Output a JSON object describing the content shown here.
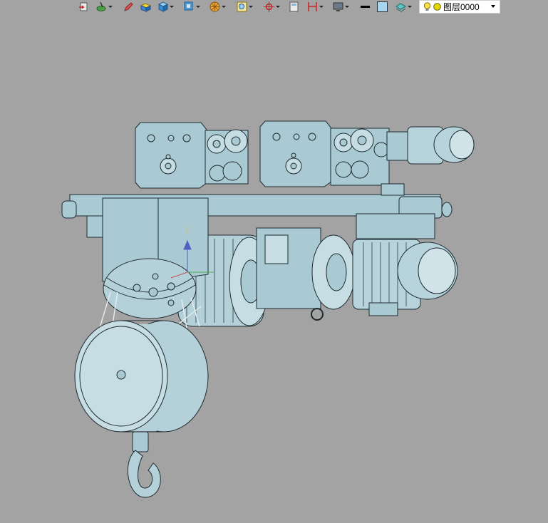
{
  "toolbar": {
    "tools": [
      {
        "name": "insert-block-icon",
        "dropdown": false
      },
      {
        "name": "globe-pen-icon",
        "dropdown": true
      },
      {
        "name": "pencil-icon",
        "dropdown": false
      },
      {
        "name": "box-yellow-icon",
        "dropdown": false
      },
      {
        "name": "cube-blue-icon",
        "dropdown": true
      },
      {
        "name": "view-cube-icon",
        "dropdown": true
      },
      {
        "name": "render-wheel-icon",
        "dropdown": true
      },
      {
        "name": "zoom-window-icon",
        "dropdown": true
      },
      {
        "name": "ucs-origin-icon",
        "dropdown": true
      },
      {
        "name": "calculator-icon",
        "dropdown": false
      },
      {
        "name": "dimension-icon",
        "dropdown": true
      },
      {
        "name": "monitor-icon",
        "dropdown": true
      },
      {
        "name": "lineweight-icon",
        "dropdown": false
      },
      {
        "name": "color-swatch-icon",
        "dropdown": false
      },
      {
        "name": "layer-stack-icon",
        "dropdown": true
      }
    ],
    "layer": {
      "name": "图层0000",
      "bulb_color": "#f6e04a",
      "sun_color": "#e6d800"
    }
  },
  "viewport": {
    "background": "#a3a3a3",
    "model_fill": "#a9c9d3",
    "model_stroke": "#1e2a30"
  }
}
